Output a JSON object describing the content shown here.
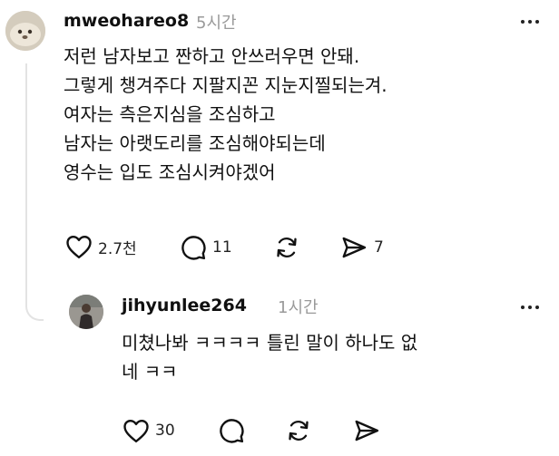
{
  "post": {
    "username": "mweohareo8",
    "time": "5시간",
    "lines": [
      "저런 남자보고 짠하고 안쓰러우면 안돼.",
      "그렇게 챙겨주다 지팔지꼰 지눈지찔되는겨.",
      "여자는 측은지심을 조심하고",
      "남자는 아랫도리를 조심해야되는데",
      "영수는 입도 조심시켜야겠어"
    ],
    "likes": "2.7천",
    "replies": "11",
    "reposts": "",
    "shares": "7"
  },
  "reply": {
    "username": "jihyunlee264",
    "time": "1시간",
    "lines": [
      "미쳤나봐 ㅋㅋㅋㅋ 틀린 말이 하나도 없",
      "네 ㅋㅋ"
    ],
    "likes": "30"
  },
  "icons": {
    "like": "heart-icon",
    "comment": "comment-bubble-icon",
    "repost": "repost-icon",
    "share": "send-icon",
    "more": "more-icon"
  },
  "colors": {
    "text": "#101010",
    "muted": "#9a9a9a",
    "line": "#e3e3e3"
  }
}
